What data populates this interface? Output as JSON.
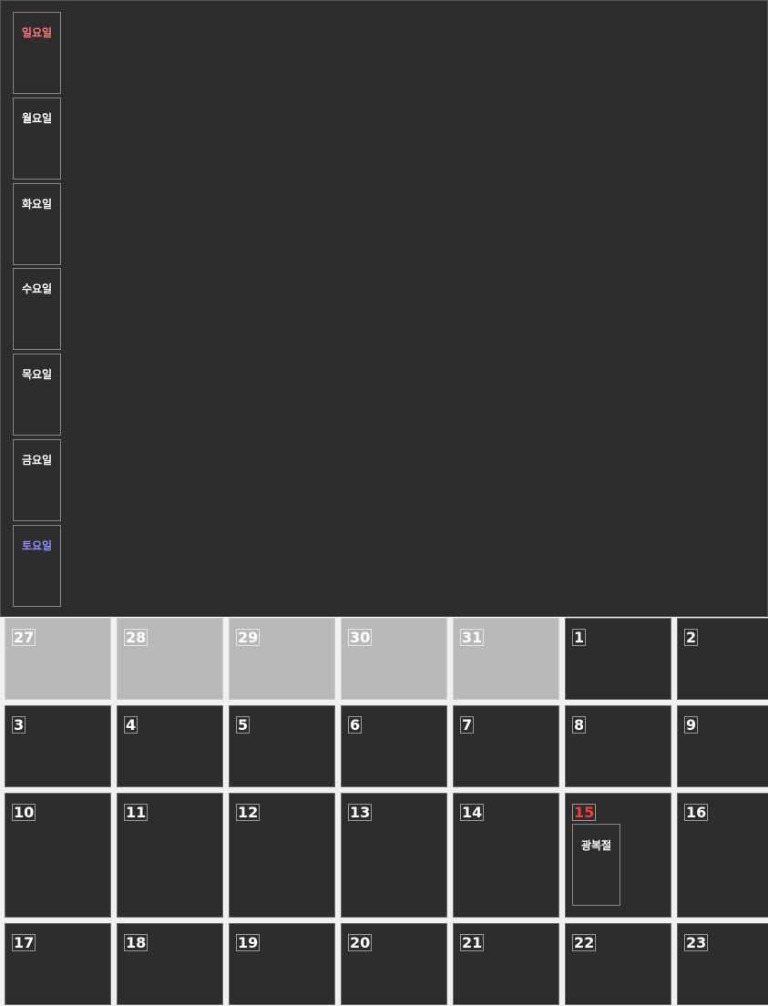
{
  "colors": {
    "sunday": "#ff7a7a",
    "saturday": "#8f8fff",
    "holiday": "#ff3b3b"
  },
  "weekdays": [
    "일요일",
    "월요일",
    "화요일",
    "수요일",
    "목요일",
    "금요일",
    "토요일"
  ],
  "weeks": [
    [
      {
        "day": "27",
        "out": true
      },
      {
        "day": "28",
        "out": true
      },
      {
        "day": "29",
        "out": true
      },
      {
        "day": "30",
        "out": true
      },
      {
        "day": "31",
        "out": true
      },
      {
        "day": "1"
      },
      {
        "day": "2"
      }
    ],
    [
      {
        "day": "3"
      },
      {
        "day": "4"
      },
      {
        "day": "5"
      },
      {
        "day": "6"
      },
      {
        "day": "7"
      },
      {
        "day": "8"
      },
      {
        "day": "9"
      }
    ],
    [
      {
        "day": "10"
      },
      {
        "day": "11"
      },
      {
        "day": "12"
      },
      {
        "day": "13"
      },
      {
        "day": "14"
      },
      {
        "day": "15",
        "holiday": true,
        "event": "광복절"
      },
      {
        "day": "16"
      }
    ],
    [
      {
        "day": "17"
      },
      {
        "day": "18"
      },
      {
        "day": "19"
      },
      {
        "day": "20"
      },
      {
        "day": "21"
      },
      {
        "day": "22"
      },
      {
        "day": "23"
      }
    ]
  ]
}
